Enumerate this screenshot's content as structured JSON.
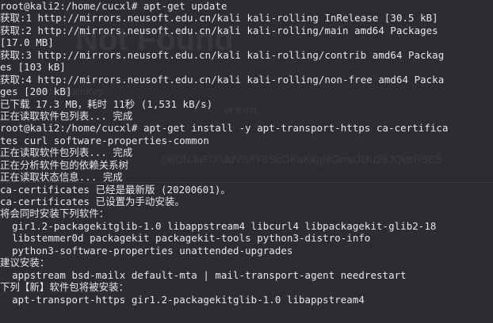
{
  "background_ghost": {
    "title": "Not Found",
    "fragment_1": "NoSuchKey",
    "fragment_2": "ot exist.",
    "fragment_3": "06UNJuF/XuldV5AY8ScOKaKkgIsGmoJl3u28JQusR5E5"
  },
  "terminal": {
    "lines": [
      "root@kali2:/home/cucxl# apt-get update",
      "获取:1 http://mirrors.neusoft.edu.cn/kali kali-rolling InRelease [30.5 kB]",
      "获取:2 http://mirrors.neusoft.edu.cn/kali kali-rolling/main amd64 Packages",
      "[17.0 MB]",
      "获取:3 http://mirrors.neusoft.edu.cn/kali kali-rolling/contrib amd64 Packag",
      "es [103 kB]",
      "获取:4 http://mirrors.neusoft.edu.cn/kali kali-rolling/non-free amd64 Packa",
      "ges [200 kB]",
      "已下载 17.3 MB，耗时 11秒 (1,531 kB/s)",
      "正在读取软件包列表... 完成",
      "root@kali2:/home/cucxl# apt-get install -y apt-transport-https ca-certifica",
      "tes curl software-properties-common",
      "正在读取软件包列表... 完成",
      "正在分析软件包的依赖关系树",
      "正在读取状态信息... 完成",
      "ca-certificates 已经是最新版 (20200601)。",
      "ca-certificates 已设置为手动安装。",
      "将会同时安装下列软件：",
      "  gir1.2-packagekitglib-1.0 libappstream4 libcurl4 libpackagekit-glib2-18",
      "  libstemmer0d packagekit packagekit-tools python3-distro-info",
      "  python3-software-properties unattended-upgrades",
      "建议安装：",
      "  appstream bsd-mailx default-mta | mail-transport-agent needrestart",
      "下列【新】软件包将被安装：",
      "  apt-transport-https gir1.2-packagekitglib-1.0 libappstream4"
    ]
  }
}
